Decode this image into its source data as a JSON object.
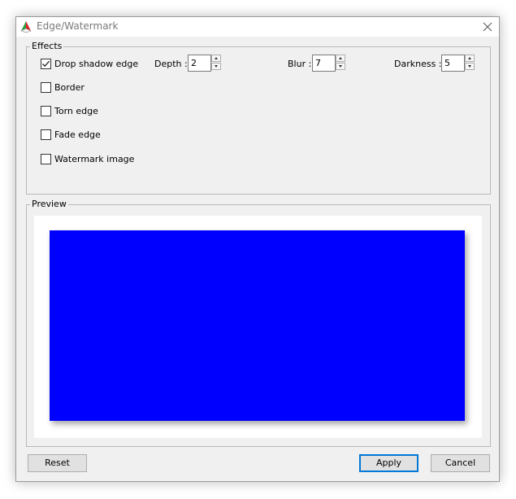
{
  "window": {
    "title": "Edge/Watermark",
    "icon": "app-icon",
    "close_icon": "close-icon"
  },
  "effects": {
    "group_label": "Effects",
    "options": [
      {
        "label": "Drop shadow edge",
        "checked": true
      },
      {
        "label": "Border",
        "checked": false
      },
      {
        "label": "Torn edge",
        "checked": false
      },
      {
        "label": "Fade edge",
        "checked": false
      },
      {
        "label": "Watermark image",
        "checked": false
      }
    ],
    "depth": {
      "label": "Depth :",
      "value": "2"
    },
    "blur": {
      "label": "Blur :",
      "value": "7"
    },
    "darkness": {
      "label": "Darkness :",
      "value": "5"
    }
  },
  "preview": {
    "group_label": "Preview",
    "fill_color": "#0000ff"
  },
  "buttons": {
    "reset": "Reset",
    "apply": "Apply",
    "cancel": "Cancel"
  },
  "colors": {
    "dialog_bg": "#f0f0f0",
    "accent": "#0078d7"
  }
}
